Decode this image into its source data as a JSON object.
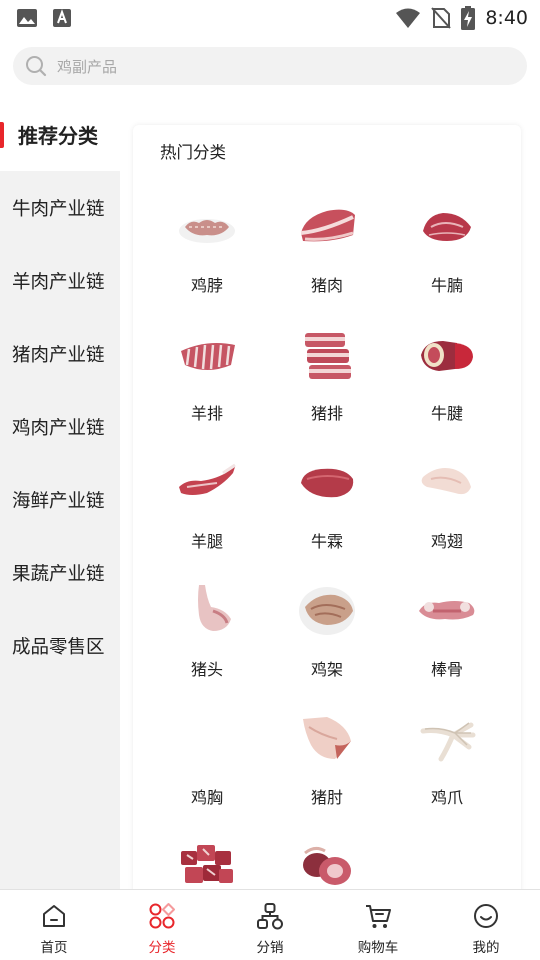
{
  "status_bar": {
    "time": "8:40"
  },
  "search": {
    "placeholder": "鸡副产品"
  },
  "categories": [
    {
      "label": "推荐分类",
      "active": true
    },
    {
      "label": "牛肉产业链"
    },
    {
      "label": "羊肉产业链"
    },
    {
      "label": "猪肉产业链"
    },
    {
      "label": "鸡肉产业链"
    },
    {
      "label": "海鲜产业链"
    },
    {
      "label": "果蔬产业链"
    },
    {
      "label": "成品零售区"
    }
  ],
  "hot": {
    "title": "热门分类",
    "products": [
      {
        "name": "鸡脖",
        "icon": "chicken-neck-image"
      },
      {
        "name": "猪肉",
        "icon": "pork-image"
      },
      {
        "name": "牛腩",
        "icon": "beef-brisket-image"
      },
      {
        "name": "羊排",
        "icon": "lamb-ribs-image"
      },
      {
        "name": "猪排",
        "icon": "pork-ribs-image"
      },
      {
        "name": "牛腱",
        "icon": "beef-shank-image"
      },
      {
        "name": "羊腿",
        "icon": "lamb-leg-image"
      },
      {
        "name": "牛霖",
        "icon": "beef-round-image"
      },
      {
        "name": "鸡翅",
        "icon": "chicken-wing-image"
      },
      {
        "name": "猪头",
        "icon": "pig-head-image"
      },
      {
        "name": "鸡架",
        "icon": "chicken-frame-image"
      },
      {
        "name": "棒骨",
        "icon": "bone-image"
      },
      {
        "name": "鸡胸",
        "icon": "chicken-breast-image"
      },
      {
        "name": "猪肘",
        "icon": "pork-knuckle-image"
      },
      {
        "name": "鸡爪",
        "icon": "chicken-feet-image"
      },
      {
        "name": "",
        "icon": "cubed-meat-image"
      },
      {
        "name": "",
        "icon": "organ-meat-image"
      }
    ]
  },
  "tabbar": [
    {
      "label": "首页",
      "icon": "home-icon"
    },
    {
      "label": "分类",
      "icon": "category-icon",
      "active": true
    },
    {
      "label": "分销",
      "icon": "distribution-icon"
    },
    {
      "label": "购物车",
      "icon": "cart-icon"
    },
    {
      "label": "我的",
      "icon": "profile-icon"
    }
  ],
  "colors": {
    "accent": "#e8262b",
    "meat": "#c94a57",
    "fat": "#f3d7d7"
  }
}
